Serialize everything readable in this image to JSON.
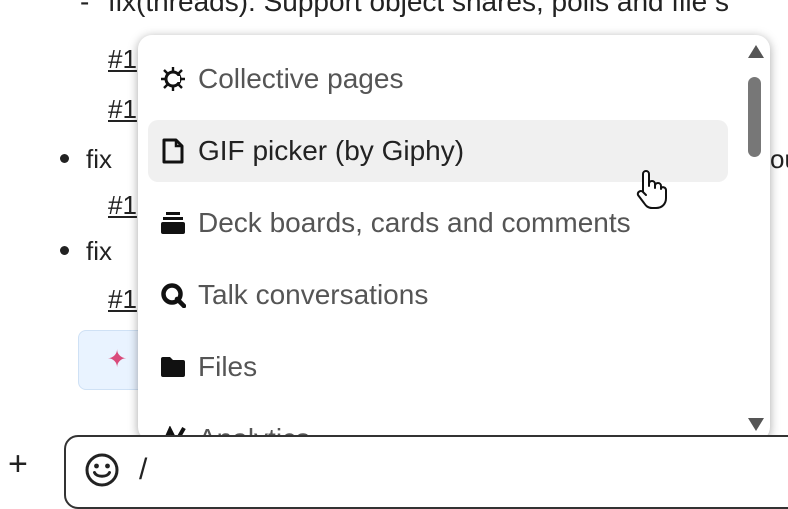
{
  "message": {
    "top_line": "fix(threads): Support object shares, polls and file s",
    "refs": [
      "#1",
      "#1",
      "#1",
      "#1"
    ],
    "bullets": [
      "fix",
      "fix"
    ],
    "peek_text": "ou"
  },
  "popup": {
    "items": [
      {
        "label": "Collective pages",
        "icon": "collectives-icon"
      },
      {
        "label": "GIF picker (by Giphy)",
        "icon": "file-icon"
      },
      {
        "label": "Deck boards, cards and comments",
        "icon": "deck-icon"
      },
      {
        "label": "Talk conversations",
        "icon": "talk-icon"
      },
      {
        "label": "Files",
        "icon": "folder-icon"
      },
      {
        "label": "Analytics",
        "icon": "analytics-icon"
      }
    ]
  },
  "composer": {
    "text": "/",
    "add_label": "+"
  }
}
